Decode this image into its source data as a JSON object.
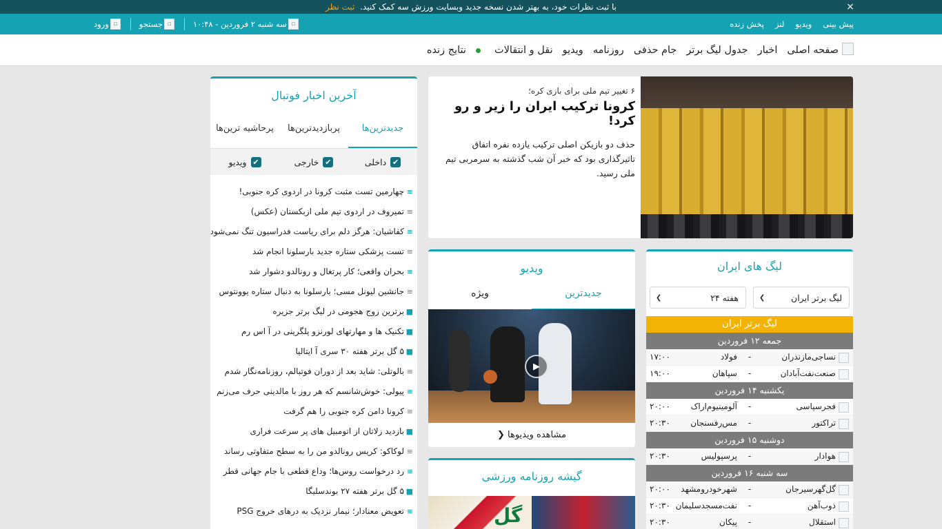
{
  "notice": {
    "text": "با ثبت نظرات خود، به بهتر شدن نسخه جدید وبسایت ورزش سه کمک کنید.",
    "link": "ثبت نظر",
    "close": "×"
  },
  "topbar": {
    "links": [
      "پیش بینی",
      "ویدیو",
      "لنز",
      "پخش زنده"
    ],
    "datetime": "سه شنبه ۲ فروردین - ۱۰:۴۸",
    "search": "جستجو",
    "login": "ورود"
  },
  "nav": {
    "items": [
      "صفحه اصلی",
      "اخبار",
      "جدول لیگ برتر",
      "جام حذفی",
      "روزنامه",
      "ویدیو",
      "نقل و انتقالات",
      "نتایج زنده"
    ]
  },
  "hero": {
    "pretitle": "۶ تغییر تیم ملی برای بازی کره؛",
    "title": "کرونا ترکیب ایران را زیر و رو کرد!",
    "summary": "حذف دو بازیکن اصلی ترکیب یازده نفره اتفاق تاثیرگذاری بود که خبر آن شب گذشته به سرمربی تیم ملی رسید."
  },
  "leagues": {
    "title": "لیگ های ایران",
    "league_select": "لیگ برتر ایران",
    "week_select": "هفته ۲۴",
    "league_title": "لیگ برتر ایران",
    "days": [
      {
        "date": "جمعه ۱۲ فروردین",
        "matches": [
          {
            "home": "نساجی‌مازندران",
            "away": "فولاد",
            "time": "۱۷:۰۰"
          },
          {
            "home": "صنعت‌نفت‌آبادان",
            "away": "سپاهان",
            "time": "۱۹:۰۰"
          }
        ]
      },
      {
        "date": "یکشنبه ۱۴ فروردین",
        "matches": [
          {
            "home": "فجرسپاسی",
            "away": "آلومینیوم‌اراک",
            "time": "۲۰:۰۰"
          },
          {
            "home": "تراکتور",
            "away": "مس‌رفسنجان",
            "time": "۲۰:۳۰"
          }
        ]
      },
      {
        "date": "دوشنبه ۱۵ فروردین",
        "matches": [
          {
            "home": "هوادار",
            "away": "پرسپولیس",
            "time": "۲۰:۳۰"
          }
        ]
      },
      {
        "date": "سه شنبه ۱۶ فروردین",
        "matches": [
          {
            "home": "گل‌گهرسیرجان",
            "away": "شهرخودرومشهد",
            "time": "۲۰:۰۰"
          },
          {
            "home": "ذوب‌آهن",
            "away": "نفت‌مسجدسلیمان",
            "time": "۲۰:۳۰"
          },
          {
            "home": "استقلال",
            "away": "پیکان",
            "time": "۲۰:۳۰"
          }
        ]
      }
    ]
  },
  "video": {
    "title": "ویدیو",
    "tabs": [
      "جدیدترین",
      "ویژه"
    ],
    "more": "مشاهده ویدیوها"
  },
  "papers": {
    "title": "گیشه روزنامه ورزشی"
  },
  "news": {
    "title": "آخرین اخبار فوتبال",
    "tabs": [
      "جدیدترین‌ها",
      "پربازدیدترین‌ها",
      "پرحاشیه ترین‌ها"
    ],
    "filters": [
      "داخلی",
      "خارجی",
      "ویدیو"
    ],
    "items": [
      {
        "text": "چهارمین تست مثبت کرونا در اردوی کره جنوبی!",
        "type": "text"
      },
      {
        "text": "تمیروف در اردوی تیم ملی ازبکستان (عکس)",
        "type": "text"
      },
      {
        "text": "کفاشیان: هرگز دلم برای ریاست فدراسیون تنگ نمی‌شود",
        "type": "text"
      },
      {
        "text": "تست پزشکی ستاره جدید بارسلونا انجام شد",
        "type": "text"
      },
      {
        "text": "بحران واقعی؛ کار پرتغال و رونالدو دشوار شد",
        "type": "text"
      },
      {
        "text": "جانشین لیونل مسی؛ بارسلونا به دنبال ستاره یوونتوس",
        "type": "text"
      },
      {
        "text": "برترین زوج هجومی در لیگ برتر جزیره",
        "type": "video"
      },
      {
        "text": "تکنیک ها و مهارتهای لورنزو پلگرینی در آ اس رم",
        "type": "video"
      },
      {
        "text": "۵ گل برتر هفته ۳۰ سری آ ایتالیا",
        "type": "video"
      },
      {
        "text": "بالوتلی: شاید بعد از دوران فوتبالم، روزنامه‌نگار شدم",
        "type": "text"
      },
      {
        "text": "پیولی: خوش‌شانسم که هر روز با مالدینی حرف می‌زنم",
        "type": "text"
      },
      {
        "text": "کرونا دامن کره جنوبی را هم گرفت",
        "type": "text"
      },
      {
        "text": "بازدید زلاتان از اتومبیل های پر سرعت فراری",
        "type": "video"
      },
      {
        "text": "لوکاکو: کریس رونالدو من را به سطح متفاوتی رساند",
        "type": "text"
      },
      {
        "text": "رد درخواست روس‌ها؛ وداع قطعی با جام جهانی قطر",
        "type": "text"
      },
      {
        "text": "۵ گل برتر هفته ۲۷ بوندسلیگا",
        "type": "video"
      },
      {
        "text": "تعویض معنادار؛ نیمار نزدیک به درهای خروج PSG",
        "type": "text"
      }
    ]
  },
  "colors": {
    "accent": "#15a3b3",
    "notice_bg": "#14525d",
    "league_bar": "#f2b304",
    "day_header": "#7b7b7b",
    "live_dot": "#2e9e3c"
  }
}
